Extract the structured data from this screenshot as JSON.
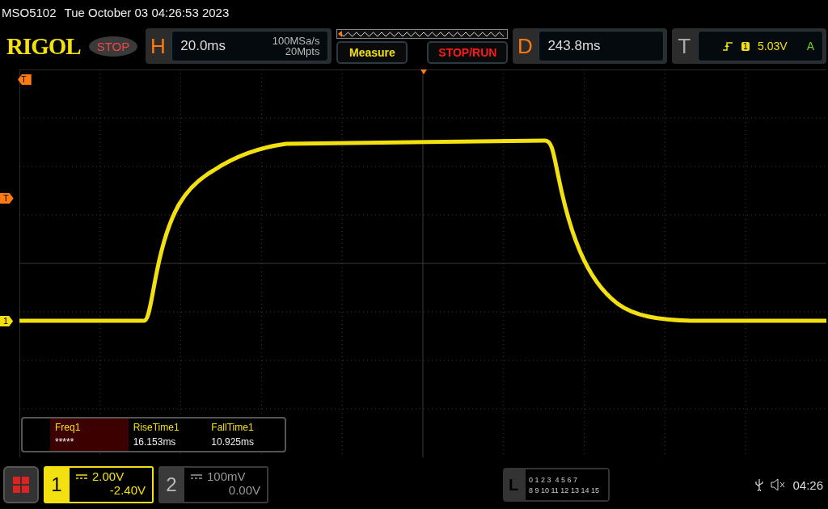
{
  "status_line": {
    "model": "MSO5102",
    "datetime": "Tue October 03 04:26:53 2023"
  },
  "header": {
    "logo": "RIGOL",
    "run_state": "STOP",
    "horizontal": {
      "label": "H",
      "timebase": "20.0ms",
      "sample_rate": "100MSa/s",
      "memory_depth": "20Mpts"
    },
    "buttons": [
      {
        "label": "Measure",
        "kind": "measure"
      },
      {
        "label": "STOP/RUN",
        "kind": "run"
      }
    ],
    "delay": {
      "label": "D",
      "value": "243.8ms"
    },
    "trigger": {
      "label": "T",
      "source": "1",
      "level": "5.03V",
      "mode": "A"
    }
  },
  "markers": [
    {
      "label": "T",
      "kind": "position"
    },
    {
      "label": "T",
      "kind": "level"
    },
    {
      "label": "1",
      "kind": "channel"
    }
  ],
  "measurements": [
    {
      "name": "Freq1",
      "value": "*****",
      "selected": true
    },
    {
      "name": "RiseTime1",
      "value": "16.153ms",
      "selected": false
    },
    {
      "name": "FallTime1",
      "value": "10.925ms",
      "selected": false
    }
  ],
  "channels": [
    {
      "number": "1",
      "scale": "2.00V",
      "offset": "-2.40V",
      "active": true
    },
    {
      "number": "2",
      "scale": "100mV",
      "offset": "0.00V",
      "active": false
    }
  ],
  "logic": {
    "label": "L",
    "rows": [
      "0 1 2 3  4 5 6 7",
      "8 9 10 11 12 13 14 15"
    ]
  },
  "clock": "04:26"
}
